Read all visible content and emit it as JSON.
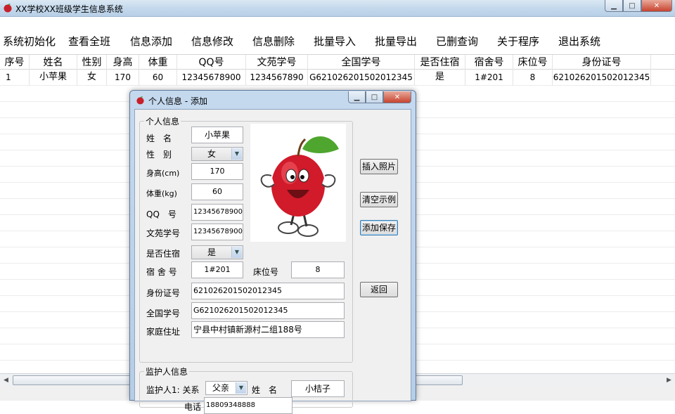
{
  "window": {
    "title": "XX学校XX班级学生信息系统"
  },
  "menu": [
    "系统初始化",
    "查看全班",
    "信息添加",
    "信息修改",
    "信息删除",
    "批量导入",
    "批量导出",
    "已删查询",
    "关于程序",
    "退出系统"
  ],
  "grid": {
    "headers": [
      "序号",
      "姓名",
      "性别",
      "身高",
      "体重",
      "QQ号",
      "文苑学号",
      "全国学号",
      "是否住宿",
      "宿舍号",
      "床位号",
      "身份证号"
    ],
    "rows": [
      [
        "1",
        "小苹果",
        "女",
        "170",
        "60",
        "12345678900",
        "1234567890",
        "G621026201502012345",
        "是",
        "1#201",
        "8",
        "621026201502012345"
      ]
    ]
  },
  "dialog": {
    "title": "个人信息 - 添加",
    "personal_legend": "个人信息",
    "labels": {
      "name": "姓　名",
      "gender": "性　别",
      "height": "身高(cm)",
      "weight": "体重(kg)",
      "qq": "QQ　号",
      "wenyuan": "文苑学号",
      "boarding": "是否住宿",
      "dorm": "宿 舍 号",
      "bed": "床位号",
      "idcard": "身份证号",
      "national": "全国学号",
      "address": "家庭住址"
    },
    "values": {
      "name": "小苹果",
      "gender": "女",
      "height": "170",
      "weight": "60",
      "qq": "12345678900",
      "wenyuan": "12345678900",
      "boarding": "是",
      "dorm": "1#201",
      "bed": "8",
      "idcard": "621026201502012345",
      "national": "G621026201502012345",
      "address": "宁县中村镇新源村二组188号"
    },
    "buttons": {
      "insert_photo": "插入照片",
      "clear_example": "清空示例",
      "add_save": "添加保存",
      "back": "返回"
    },
    "guardian": {
      "legend": "监护人信息",
      "g1_label": "监护人1: 关系",
      "relation": "父亲",
      "name_label": "姓　名",
      "name": "小桔子",
      "phone_label": "电话",
      "phone": "18809348888"
    }
  }
}
